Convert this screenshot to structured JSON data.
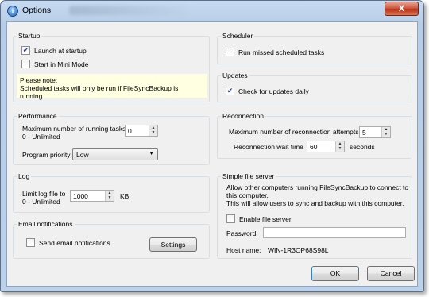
{
  "window": {
    "title": "Options",
    "close_glyph": "X"
  },
  "startup": {
    "title": "Startup",
    "launch_label": "Launch at startup",
    "launch_checked": true,
    "mini_label": "Start in Mini Mode",
    "mini_checked": false,
    "note_line1": "Please note:",
    "note_line2": "Scheduled tasks will only be run if FileSyncBackup is running."
  },
  "scheduler": {
    "title": "Scheduler",
    "missed_label": "Run missed scheduled tasks",
    "missed_checked": false
  },
  "updates": {
    "title": "Updates",
    "check_label": "Check for updates daily",
    "check_checked": true
  },
  "performance": {
    "title": "Performance",
    "max_tasks_label": "Maximum number of running tasks",
    "max_tasks_sub": "0 - Unlimited",
    "max_tasks_value": "0",
    "priority_label": "Program priority:",
    "priority_value": "Low"
  },
  "reconnection": {
    "title": "Reconnection",
    "attempts_label": "Maximum number of reconnection attempts",
    "attempts_value": "5",
    "wait_label": "Reconnection wait time",
    "wait_value": "60",
    "wait_unit": "seconds"
  },
  "log": {
    "title": "Log",
    "limit_label": "Limit log file to",
    "limit_sub": "0 - Unlimited",
    "limit_value": "1000",
    "limit_unit": "KB"
  },
  "server": {
    "title": "Simple file server",
    "desc_line1": "Allow other computers running FileSyncBackup to connect to",
    "desc_line2": "this computer.",
    "desc_line3": "This will allow users to sync and backup with this computer.",
    "enable_label": "Enable file server",
    "enable_checked": false,
    "password_label": "Password:",
    "password_value": "",
    "host_label": "Host name:",
    "host_value": "WIN-1R3OP68S98L"
  },
  "email": {
    "title": "Email notifications",
    "send_label": "Send email notifications",
    "send_checked": false,
    "settings_button": "Settings"
  },
  "buttons": {
    "ok": "OK",
    "cancel": "Cancel"
  },
  "icons": {
    "spin_up": "▲",
    "spin_down": "▼",
    "dropdown": "▼"
  }
}
